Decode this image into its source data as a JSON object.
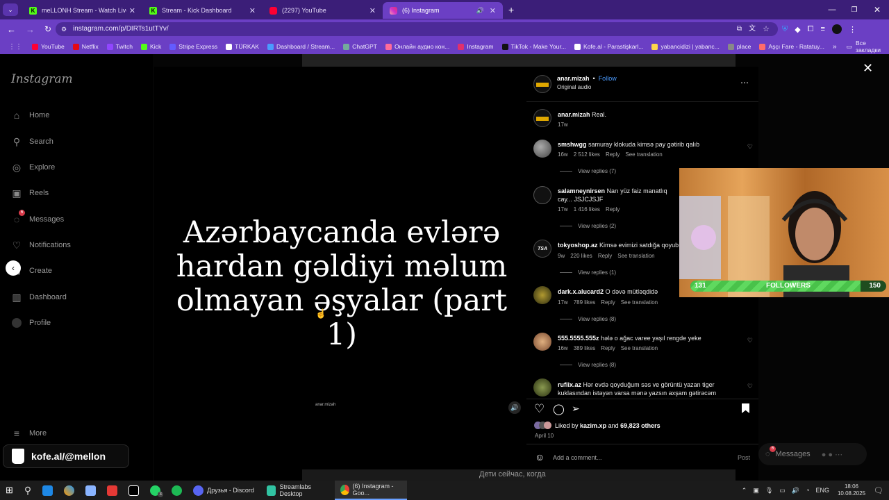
{
  "tabs": [
    {
      "title": "meLLONH Stream - Watch Live",
      "favicon_color": "#53fc18"
    },
    {
      "title": "Stream - Kick Dashboard",
      "favicon_color": "#53fc18"
    },
    {
      "title": "(2297) YouTube",
      "favicon_color": "#ff0033"
    },
    {
      "title": "(6) Instagram",
      "favicon_color": "#e1306c"
    }
  ],
  "address_bar": {
    "url": "instagram.com/p/DIRTs1utTYv/"
  },
  "bookmarks": [
    "YouTube",
    "Netflix",
    "Twitch",
    "Kick",
    "Stripe Express",
    "TÜRKAK",
    "Dashboard / Stream...",
    "ChatGPT",
    "Онлайн аудио кон...",
    "Instagram",
    "TikTok - Make Your...",
    "Kofe.al - Parastişkarl...",
    "yabancidizi | yabanc...",
    "place",
    "Aşçı Fare - Ratatuy..."
  ],
  "bookmarks_all": "Все закладки",
  "nav": {
    "logo": "Instagram",
    "items": [
      "Home",
      "Search",
      "Explore",
      "Reels",
      "Messages",
      "Notifications",
      "Create",
      "Dashboard",
      "Profile"
    ],
    "messages_badge": "6",
    "more": "More"
  },
  "video": {
    "caption": "Azərbaycanda evlərə hardan gəldiyi məlum olmayan əşyalar (part 1)",
    "watermark": "anar.mizah"
  },
  "post": {
    "author": "anar.mizah",
    "follow": "Follow",
    "audio": "Original audio",
    "caption_text": "Real.",
    "caption_time": "17w",
    "comments": [
      {
        "user": "smshwgg",
        "text": "samuray klokuda kimsə pay gətirib qalıb",
        "time": "16w",
        "likes": "2 512 likes",
        "reply": "Reply",
        "translation": "See translation",
        "replies": "View replies (7)"
      },
      {
        "user": "salamneynirsen",
        "text": "Narı yüz faiz manatlıq cay... JSJCJSJF",
        "time": "17w",
        "likes": "1 416 likes",
        "reply": "Reply",
        "translation": "",
        "replies": "View replies (2)"
      },
      {
        "user": "tokyoshop.az",
        "text": "Kimsə evimizi satdığa qoyub",
        "time": "9w",
        "likes": "220 likes",
        "reply": "Reply",
        "translation": "See translation",
        "replies": "View replies (1)"
      },
      {
        "user": "dark.x.alucard2",
        "text": "O dəvə mütləqdidə",
        "time": "17w",
        "likes": "789 likes",
        "reply": "Reply",
        "translation": "See translation",
        "replies": "View replies (8)"
      },
      {
        "user": "555.5555.555z",
        "text": "hələ o ağac varee yaşıl rengde yeke",
        "time": "16w",
        "likes": "389 likes",
        "reply": "Reply",
        "translation": "See translation",
        "replies": "View replies (8)"
      },
      {
        "user": "ruflix.az",
        "text": "Hər evdə qoyduğum səs ve görüntü yazan tiger kuklasından istəyən varsa mənə yazsın axşam gətirəcəm",
        "time": "",
        "likes": "",
        "reply": "",
        "translation": "",
        "replies": ""
      }
    ],
    "liked_by_prefix": "Liked by",
    "liked_by_user": "kazim.xp",
    "liked_by_and": "and",
    "liked_by_others": "69,823 others",
    "date": "April 10",
    "add_comment": "Add a comment...",
    "post_button": "Post"
  },
  "overlay": {
    "followers_label": "FOLLOWERS",
    "followers_current": "131",
    "followers_goal": "150",
    "followers_progress": 0.87,
    "kofe": "kofe.al/@mellon",
    "messages": "Messages",
    "messages_badge": "6",
    "subtitle": "Дети сейчас, когда"
  },
  "taskbar": {
    "apps": [
      {
        "label": "Друзья - Discord"
      },
      {
        "label": "Streamlabs Desktop"
      },
      {
        "label": "(6) Instagram - Goo..."
      }
    ],
    "lang": "ENG",
    "time": "18:06",
    "date": "10.08.2025",
    "whatsapp_badge": "3"
  }
}
